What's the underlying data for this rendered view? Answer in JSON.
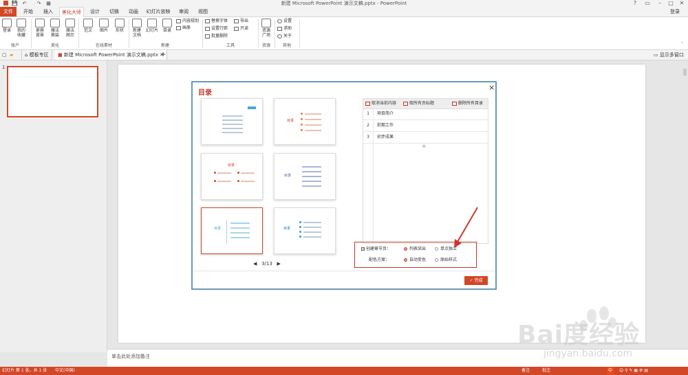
{
  "window": {
    "title": "新建 Microsoft PowerPoint 演示文稿.pptx - PowerPoint",
    "login": "登录",
    "quick_access": [
      "💾",
      "↶",
      "↷",
      "▦"
    ]
  },
  "tabs": [
    "文件",
    "开始",
    "插入",
    "美化大师",
    "设计",
    "切换",
    "动画",
    "幻灯片放映",
    "审阅",
    "视图"
  ],
  "ribbon": {
    "account": {
      "label": "账户",
      "buttons": [
        "登录",
        "我的收藏"
      ]
    },
    "beautify": {
      "label": "美化",
      "buttons": [
        "更换背景",
        "魔法换装",
        "魔法图示"
      ]
    },
    "online": {
      "label": "在线素材",
      "buttons": [
        "范文",
        "图片",
        "形状"
      ]
    },
    "new": {
      "label": "新建",
      "buttons": [
        "新建文档",
        "幻灯片",
        "目录"
      ],
      "small": [
        "内容规划",
        "画册"
      ]
    },
    "tools": {
      "label": "工具",
      "small": [
        "替换字体",
        "设置行距",
        "批量删除",
        "导出",
        "只读"
      ]
    },
    "resources": {
      "label": "资源",
      "buttons": [
        "资源广场"
      ]
    },
    "other": {
      "label": "其他",
      "small": [
        "设置",
        "求助",
        "关于"
      ]
    }
  },
  "doctabs": {
    "template_zone": "模板专区",
    "document": "新建 Microsoft PowerPoint 演示文稿.pptx",
    "add": "+",
    "show_all": "显示多窗口"
  },
  "slides_panel": {
    "slide_number": "1"
  },
  "notes_placeholder": "单击此处添加备注",
  "statusbar": {
    "slide_info": "幻灯片 第 1 张，共 1 张",
    "language": "中文(中国)",
    "notes": "备注",
    "comments": "批注",
    "ime": "中"
  },
  "dialog": {
    "title": "目录",
    "close": "×",
    "templates": [
      {
        "title": "目录"
      },
      {
        "title": "目录"
      },
      {
        "title": "目录"
      },
      {
        "title": "目录"
      },
      {
        "title": "目录"
      },
      {
        "title": "目录"
      }
    ],
    "pager": {
      "prev": "◀",
      "page": "3/13",
      "next": "▶"
    },
    "toolbar": {
      "cancel_current": "取消当前内容",
      "all_titles": "取所有页标题",
      "delete_all": "删除所有目录"
    },
    "items": [
      {
        "num": "1",
        "text": "项目简介"
      },
      {
        "num": "2",
        "text": "前期工作"
      },
      {
        "num": "3",
        "text": "初步成果"
      }
    ],
    "add": "+",
    "options": {
      "create_chapter": "创建章节页：",
      "radio_list": "列表突出",
      "radio_single": "单点独立",
      "color_scheme": "配色方案：",
      "radio_auto": "自动变色",
      "radio_original": "原始样式"
    },
    "done": "完成"
  },
  "watermark": {
    "brand": "Bai度经验",
    "url": "jingyan.baidu.com"
  },
  "colors": {
    "accent": "#d24726",
    "dialog_border": "#6a9ab4"
  }
}
